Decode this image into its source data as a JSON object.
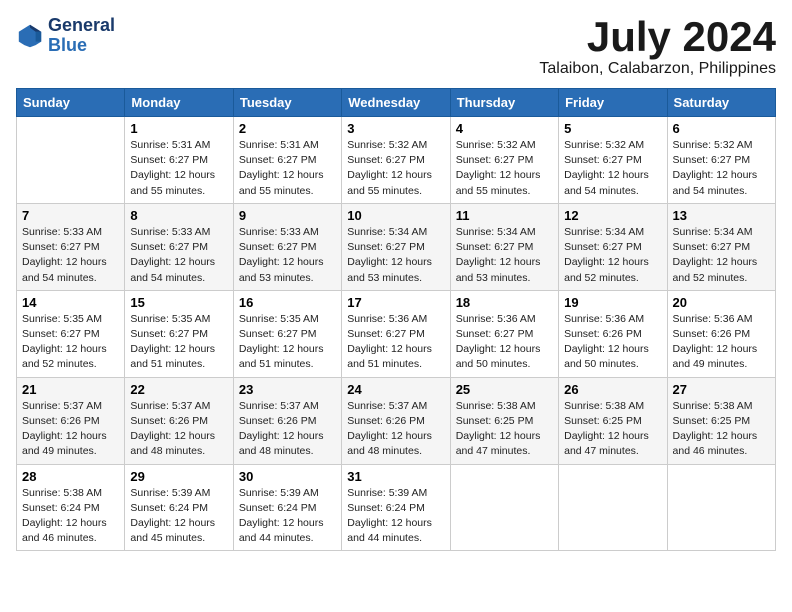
{
  "header": {
    "logo_line1": "General",
    "logo_line2": "Blue",
    "month": "July 2024",
    "location": "Talaibon, Calabarzon, Philippines"
  },
  "weekdays": [
    "Sunday",
    "Monday",
    "Tuesday",
    "Wednesday",
    "Thursday",
    "Friday",
    "Saturday"
  ],
  "weeks": [
    [
      {
        "day": "",
        "info": ""
      },
      {
        "day": "1",
        "info": "Sunrise: 5:31 AM\nSunset: 6:27 PM\nDaylight: 12 hours\nand 55 minutes."
      },
      {
        "day": "2",
        "info": "Sunrise: 5:31 AM\nSunset: 6:27 PM\nDaylight: 12 hours\nand 55 minutes."
      },
      {
        "day": "3",
        "info": "Sunrise: 5:32 AM\nSunset: 6:27 PM\nDaylight: 12 hours\nand 55 minutes."
      },
      {
        "day": "4",
        "info": "Sunrise: 5:32 AM\nSunset: 6:27 PM\nDaylight: 12 hours\nand 55 minutes."
      },
      {
        "day": "5",
        "info": "Sunrise: 5:32 AM\nSunset: 6:27 PM\nDaylight: 12 hours\nand 54 minutes."
      },
      {
        "day": "6",
        "info": "Sunrise: 5:32 AM\nSunset: 6:27 PM\nDaylight: 12 hours\nand 54 minutes."
      }
    ],
    [
      {
        "day": "7",
        "info": "Sunrise: 5:33 AM\nSunset: 6:27 PM\nDaylight: 12 hours\nand 54 minutes."
      },
      {
        "day": "8",
        "info": "Sunrise: 5:33 AM\nSunset: 6:27 PM\nDaylight: 12 hours\nand 54 minutes."
      },
      {
        "day": "9",
        "info": "Sunrise: 5:33 AM\nSunset: 6:27 PM\nDaylight: 12 hours\nand 53 minutes."
      },
      {
        "day": "10",
        "info": "Sunrise: 5:34 AM\nSunset: 6:27 PM\nDaylight: 12 hours\nand 53 minutes."
      },
      {
        "day": "11",
        "info": "Sunrise: 5:34 AM\nSunset: 6:27 PM\nDaylight: 12 hours\nand 53 minutes."
      },
      {
        "day": "12",
        "info": "Sunrise: 5:34 AM\nSunset: 6:27 PM\nDaylight: 12 hours\nand 52 minutes."
      },
      {
        "day": "13",
        "info": "Sunrise: 5:34 AM\nSunset: 6:27 PM\nDaylight: 12 hours\nand 52 minutes."
      }
    ],
    [
      {
        "day": "14",
        "info": "Sunrise: 5:35 AM\nSunset: 6:27 PM\nDaylight: 12 hours\nand 52 minutes."
      },
      {
        "day": "15",
        "info": "Sunrise: 5:35 AM\nSunset: 6:27 PM\nDaylight: 12 hours\nand 51 minutes."
      },
      {
        "day": "16",
        "info": "Sunrise: 5:35 AM\nSunset: 6:27 PM\nDaylight: 12 hours\nand 51 minutes."
      },
      {
        "day": "17",
        "info": "Sunrise: 5:36 AM\nSunset: 6:27 PM\nDaylight: 12 hours\nand 51 minutes."
      },
      {
        "day": "18",
        "info": "Sunrise: 5:36 AM\nSunset: 6:27 PM\nDaylight: 12 hours\nand 50 minutes."
      },
      {
        "day": "19",
        "info": "Sunrise: 5:36 AM\nSunset: 6:26 PM\nDaylight: 12 hours\nand 50 minutes."
      },
      {
        "day": "20",
        "info": "Sunrise: 5:36 AM\nSunset: 6:26 PM\nDaylight: 12 hours\nand 49 minutes."
      }
    ],
    [
      {
        "day": "21",
        "info": "Sunrise: 5:37 AM\nSunset: 6:26 PM\nDaylight: 12 hours\nand 49 minutes."
      },
      {
        "day": "22",
        "info": "Sunrise: 5:37 AM\nSunset: 6:26 PM\nDaylight: 12 hours\nand 48 minutes."
      },
      {
        "day": "23",
        "info": "Sunrise: 5:37 AM\nSunset: 6:26 PM\nDaylight: 12 hours\nand 48 minutes."
      },
      {
        "day": "24",
        "info": "Sunrise: 5:37 AM\nSunset: 6:26 PM\nDaylight: 12 hours\nand 48 minutes."
      },
      {
        "day": "25",
        "info": "Sunrise: 5:38 AM\nSunset: 6:25 PM\nDaylight: 12 hours\nand 47 minutes."
      },
      {
        "day": "26",
        "info": "Sunrise: 5:38 AM\nSunset: 6:25 PM\nDaylight: 12 hours\nand 47 minutes."
      },
      {
        "day": "27",
        "info": "Sunrise: 5:38 AM\nSunset: 6:25 PM\nDaylight: 12 hours\nand 46 minutes."
      }
    ],
    [
      {
        "day": "28",
        "info": "Sunrise: 5:38 AM\nSunset: 6:24 PM\nDaylight: 12 hours\nand 46 minutes."
      },
      {
        "day": "29",
        "info": "Sunrise: 5:39 AM\nSunset: 6:24 PM\nDaylight: 12 hours\nand 45 minutes."
      },
      {
        "day": "30",
        "info": "Sunrise: 5:39 AM\nSunset: 6:24 PM\nDaylight: 12 hours\nand 44 minutes."
      },
      {
        "day": "31",
        "info": "Sunrise: 5:39 AM\nSunset: 6:24 PM\nDaylight: 12 hours\nand 44 minutes."
      },
      {
        "day": "",
        "info": ""
      },
      {
        "day": "",
        "info": ""
      },
      {
        "day": "",
        "info": ""
      }
    ]
  ]
}
